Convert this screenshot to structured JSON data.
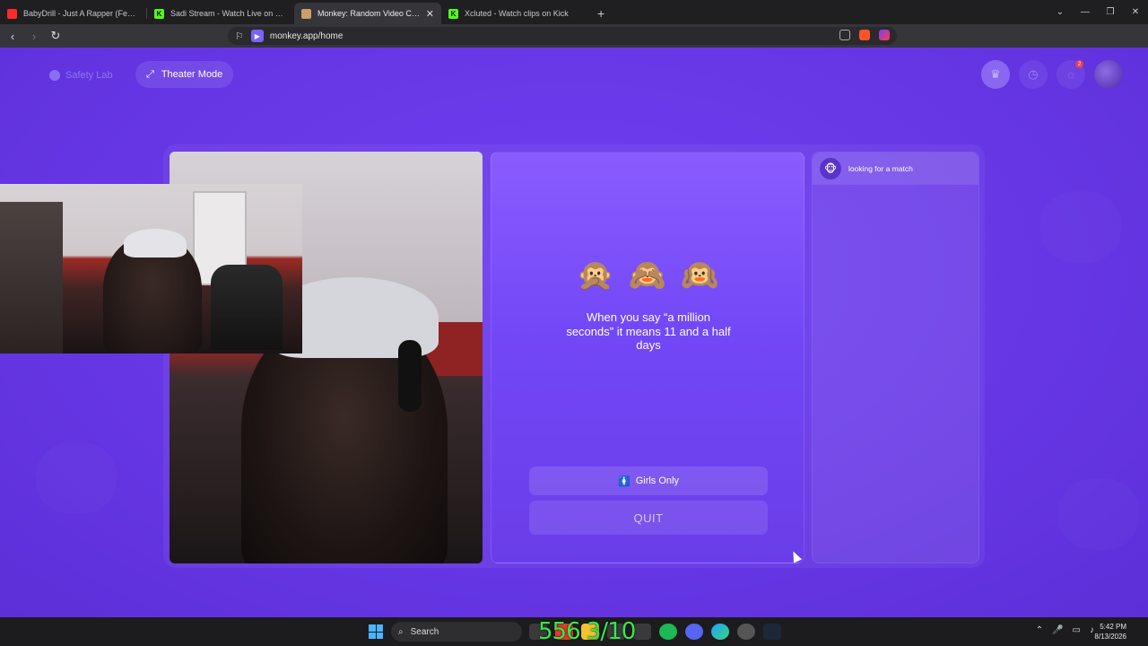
{
  "browser": {
    "tabs": [
      {
        "title": "BabyDrill - Just A Rapper (Feat. Hunx",
        "favicon_color": "#ff2a2a",
        "active": false
      },
      {
        "title": "Sadi Stream - Watch Live on Kick",
        "favicon_color": "#53fc18",
        "active": false
      },
      {
        "title": "Monkey: Random Video Chat",
        "favicon_color": "#c9a06a",
        "active": true
      },
      {
        "title": "Xcluted - Watch clips on Kick",
        "favicon_color": "#53fc18",
        "active": false
      }
    ],
    "new_tab": "+",
    "url": "monkey.app/home"
  },
  "header": {
    "safety_label": "Safety Lab",
    "theater_label": "Theater Mode",
    "icons": [
      "crown-icon",
      "history-icon",
      "chat-icon",
      "avatar"
    ],
    "notification_badge": "2"
  },
  "panel": {
    "emojis": [
      "🙊",
      "🙈",
      "🙉"
    ],
    "fact": "When you say “a million seconds” it means 11 and a half days",
    "girls_only": "Girls Only",
    "girls_icon": "🚺",
    "quit": "QUIT"
  },
  "chat": {
    "status": "looking for a match",
    "status_icon": "🐵"
  },
  "taskbar": {
    "search": "Search",
    "overlay": "556 3/10",
    "time": "5:42 PM",
    "date": "8/13/2026"
  },
  "colors": {
    "page_bg": "#6a3de8",
    "accent": "#8a5cff"
  }
}
